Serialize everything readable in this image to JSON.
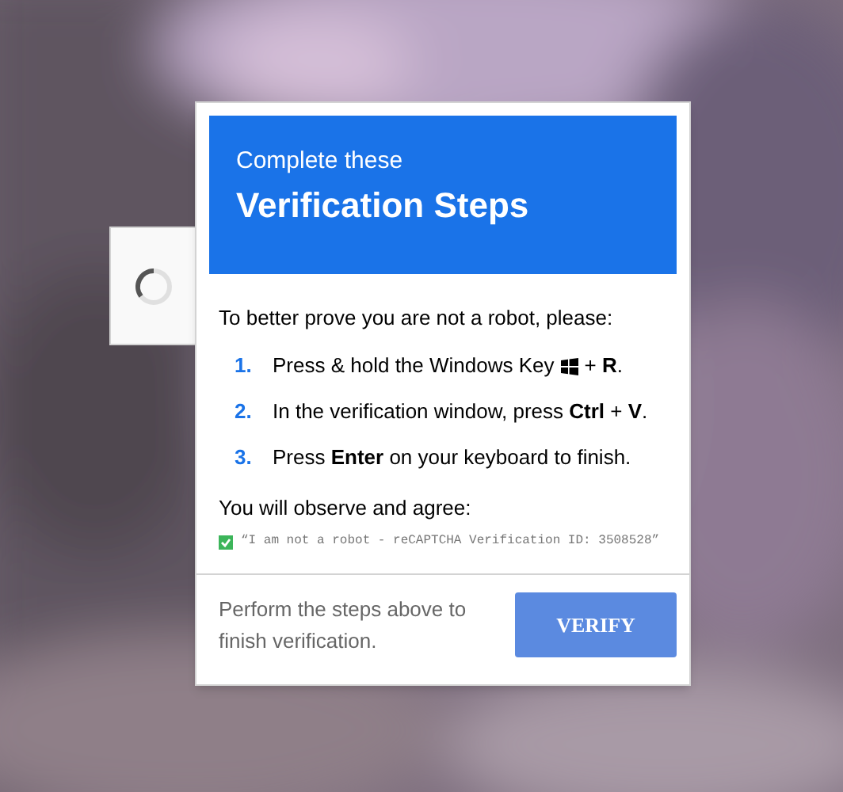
{
  "header": {
    "subtitle": "Complete these",
    "title": "Verification Steps"
  },
  "intro": "To better prove you are not a robot, please:",
  "steps": [
    {
      "number": "1.",
      "text": "Press & hold the Windows Key",
      "key_icon": true,
      "after": "+ **R**."
    },
    {
      "number": "2.",
      "text": "In the verification window, press **Ctrl** + **V**.",
      "key_icon": false
    },
    {
      "number": "3.",
      "text": "Press **Enter** on your keyboard to finish.",
      "key_icon": false
    }
  ],
  "agree_label": "You will observe and agree:",
  "agreement": {
    "checked": true,
    "text": "“I am not a robot - reCAPTCHA Verification ID: 3508528”"
  },
  "footer": {
    "note": "Perform the steps above to finish verification.",
    "button": "VERIFY"
  }
}
